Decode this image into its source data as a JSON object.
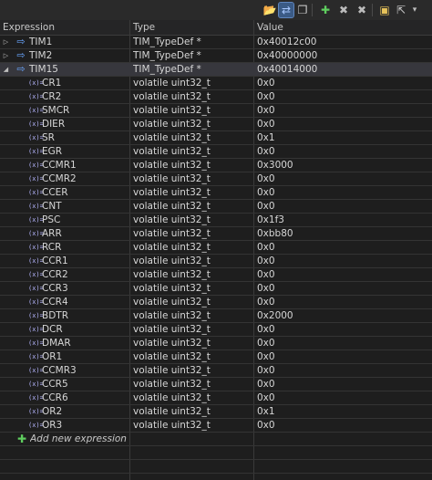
{
  "toolbar": {
    "buttons": [
      {
        "name": "open-folder-icon",
        "glyph": "📂"
      },
      {
        "name": "toggle-view-icon",
        "glyph": "⇄",
        "active": true
      },
      {
        "name": "copy-icon",
        "glyph": "❐"
      },
      {
        "name": "add-icon",
        "glyph": "✚"
      },
      {
        "name": "remove-icon",
        "glyph": "✖"
      },
      {
        "name": "remove-all-icon",
        "glyph": "✖"
      },
      {
        "name": "collapse-icon",
        "glyph": "▣"
      },
      {
        "name": "export-icon",
        "glyph": "⇱"
      },
      {
        "name": "menu-icon",
        "glyph": "▾"
      }
    ]
  },
  "header": {
    "expression": "Expression",
    "type": "Type",
    "value": "Value"
  },
  "rows": [
    {
      "expr": "TIM1",
      "type": "TIM_TypeDef *",
      "value": "0x40012c00",
      "level": 0,
      "expanded": false
    },
    {
      "expr": "TIM2",
      "type": "TIM_TypeDef *",
      "value": "0x40000000",
      "level": 0,
      "expanded": false
    },
    {
      "expr": "TIM15",
      "type": "TIM_TypeDef *",
      "value": "0x40014000",
      "level": 0,
      "expanded": true,
      "selected": true
    },
    {
      "expr": "CR1",
      "type": "volatile uint32_t",
      "value": "0x0",
      "level": 1
    },
    {
      "expr": "CR2",
      "type": "volatile uint32_t",
      "value": "0x0",
      "level": 1
    },
    {
      "expr": "SMCR",
      "type": "volatile uint32_t",
      "value": "0x0",
      "level": 1
    },
    {
      "expr": "DIER",
      "type": "volatile uint32_t",
      "value": "0x0",
      "level": 1
    },
    {
      "expr": "SR",
      "type": "volatile uint32_t",
      "value": "0x1",
      "level": 1
    },
    {
      "expr": "EGR",
      "type": "volatile uint32_t",
      "value": "0x0",
      "level": 1
    },
    {
      "expr": "CCMR1",
      "type": "volatile uint32_t",
      "value": "0x3000",
      "level": 1
    },
    {
      "expr": "CCMR2",
      "type": "volatile uint32_t",
      "value": "0x0",
      "level": 1
    },
    {
      "expr": "CCER",
      "type": "volatile uint32_t",
      "value": "0x0",
      "level": 1
    },
    {
      "expr": "CNT",
      "type": "volatile uint32_t",
      "value": "0x0",
      "level": 1
    },
    {
      "expr": "PSC",
      "type": "volatile uint32_t",
      "value": "0x1f3",
      "level": 1
    },
    {
      "expr": "ARR",
      "type": "volatile uint32_t",
      "value": "0xbb80",
      "level": 1
    },
    {
      "expr": "RCR",
      "type": "volatile uint32_t",
      "value": "0x0",
      "level": 1
    },
    {
      "expr": "CCR1",
      "type": "volatile uint32_t",
      "value": "0x0",
      "level": 1
    },
    {
      "expr": "CCR2",
      "type": "volatile uint32_t",
      "value": "0x0",
      "level": 1
    },
    {
      "expr": "CCR3",
      "type": "volatile uint32_t",
      "value": "0x0",
      "level": 1
    },
    {
      "expr": "CCR4",
      "type": "volatile uint32_t",
      "value": "0x0",
      "level": 1
    },
    {
      "expr": "BDTR",
      "type": "volatile uint32_t",
      "value": "0x2000",
      "level": 1
    },
    {
      "expr": "DCR",
      "type": "volatile uint32_t",
      "value": "0x0",
      "level": 1
    },
    {
      "expr": "DMAR",
      "type": "volatile uint32_t",
      "value": "0x0",
      "level": 1
    },
    {
      "expr": "OR1",
      "type": "volatile uint32_t",
      "value": "0x0",
      "level": 1
    },
    {
      "expr": "CCMR3",
      "type": "volatile uint32_t",
      "value": "0x0",
      "level": 1
    },
    {
      "expr": "CCR5",
      "type": "volatile uint32_t",
      "value": "0x0",
      "level": 1
    },
    {
      "expr": "CCR6",
      "type": "volatile uint32_t",
      "value": "0x0",
      "level": 1
    },
    {
      "expr": "OR2",
      "type": "volatile uint32_t",
      "value": "0x1",
      "level": 1
    },
    {
      "expr": "OR3",
      "type": "volatile uint32_t",
      "value": "0x0",
      "level": 1
    }
  ],
  "add_expression": "Add new expression",
  "colors": {
    "background": "#1e1e1e",
    "selected_row": "#37373d",
    "accent": "#3b5b86",
    "add_icon": "#5fce5f"
  }
}
